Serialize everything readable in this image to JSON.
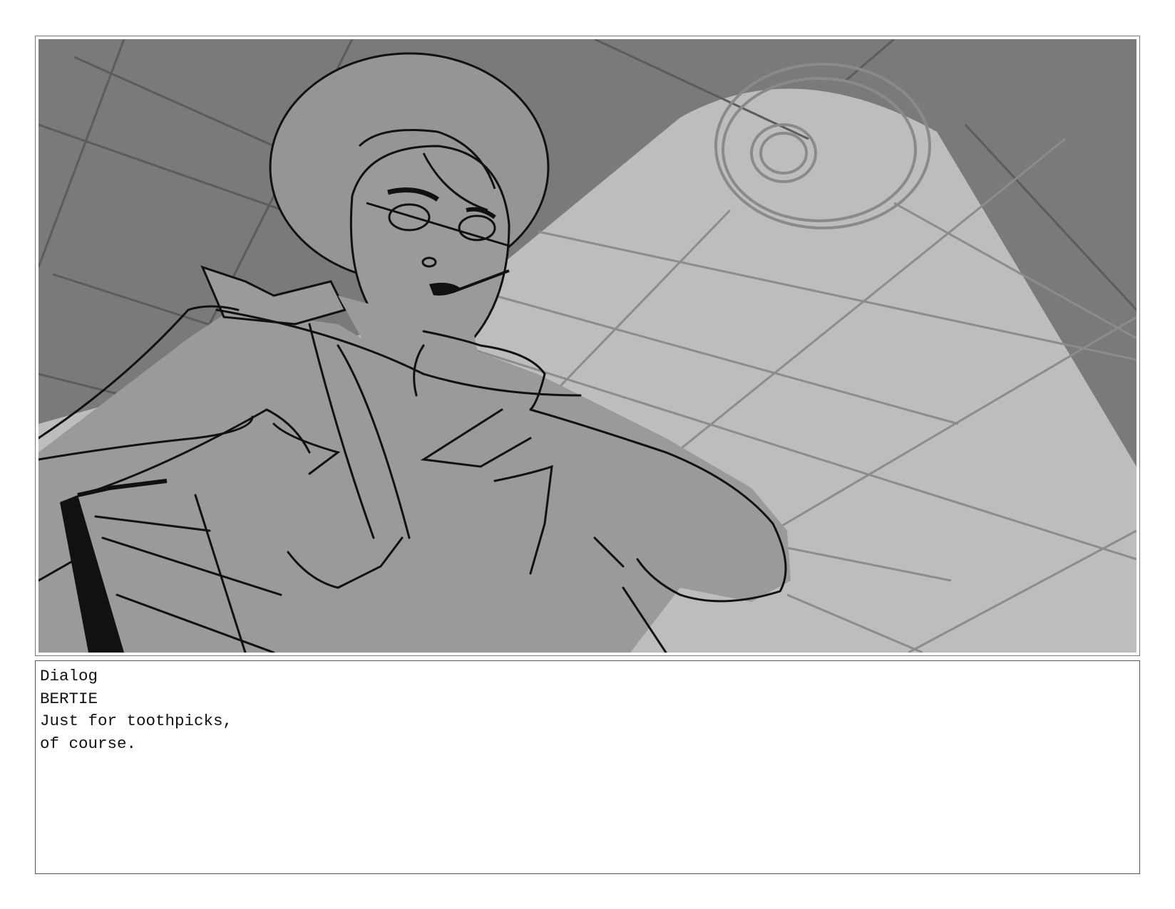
{
  "dialog": {
    "heading": "Dialog",
    "character": "BERTIE",
    "line1": "Just for toothpicks,",
    "line2": "of course."
  },
  "panel": {
    "background_color": "#7a7a7a",
    "light_color": "#bdbdbd",
    "figure_color": "#9a9a9a",
    "line_color": "#111111"
  }
}
